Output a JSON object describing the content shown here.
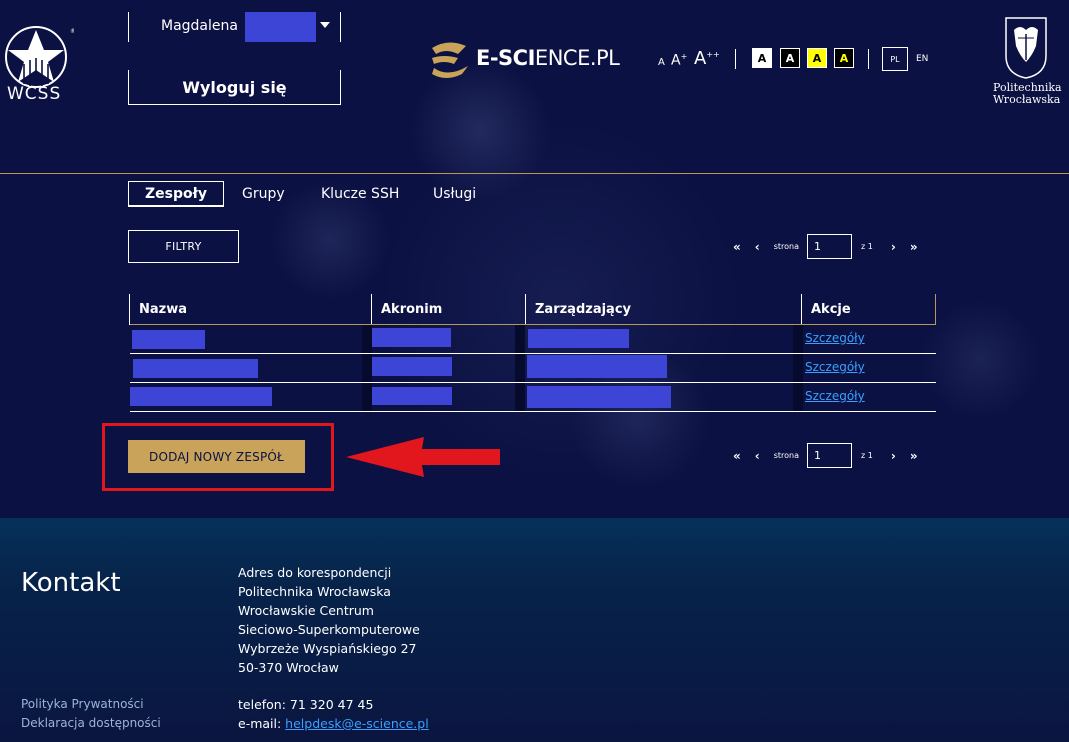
{
  "header": {
    "wcss_logo_text": "WCSS",
    "user_first_name": "Magdalena",
    "logout_label": "Wyloguj się",
    "brand_bold": "E-SCI",
    "brand_light": "ENCE.PL",
    "font_sizes": [
      "A",
      "A",
      "+",
      "A",
      "++"
    ],
    "contrast_options": [
      "A",
      "A",
      "A",
      "A"
    ],
    "languages": [
      "PL",
      "EN"
    ],
    "university_line1": "Politechnika",
    "university_line2": "Wrocławska"
  },
  "tabs": [
    {
      "label": "Zespoły",
      "active": true
    },
    {
      "label": "Grupy",
      "active": false
    },
    {
      "label": "Klucze SSH",
      "active": false
    },
    {
      "label": "Usługi",
      "active": false
    }
  ],
  "filter_label": "FILTRY",
  "pager": {
    "first": "«",
    "prev": "‹",
    "next": "›",
    "last": "»",
    "page_label": "strona",
    "page_value": "1",
    "of_label": "z 1"
  },
  "table": {
    "headers": [
      "Nazwa",
      "Akronim",
      "Zarządzający",
      "Akcje"
    ],
    "rows": [
      {
        "action": "Szczegóły"
      },
      {
        "action": "Szczegóły"
      },
      {
        "action": "Szczegóły"
      }
    ]
  },
  "add_team_label": "DODAJ NOWY ZESPÓŁ",
  "footer": {
    "title": "Kontakt",
    "privacy": "Polityka Prywatności",
    "accessibility": "Deklaracja dostępności",
    "address": [
      "Adres do korespondencji",
      "Politechnika Wrocławska",
      "Wrocławskie Centrum",
      "Sieciowo-Superkomputerowe",
      "Wybrzeże Wyspiańskiego 27",
      "50-370 Wrocław"
    ],
    "phone": "telefon: 71 320 47 45",
    "email_label": "e-mail: ",
    "email": "helpdesk@e-science.pl"
  },
  "colors": {
    "background": "#0b1142",
    "accent_gold": "#c9a35a",
    "redaction": "#3d45d6",
    "highlight_red": "#e2161d",
    "link": "#3aa0ff"
  }
}
